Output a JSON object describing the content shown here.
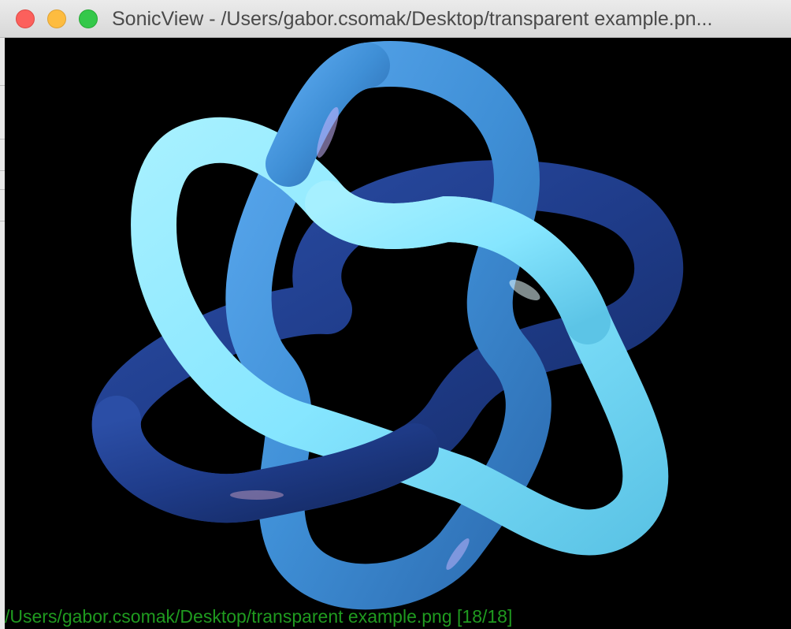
{
  "window": {
    "title": "SonicView - /Users/gabor.csomak/Desktop/transparent example.pn...",
    "controls": {
      "close_icon": "close-icon",
      "minimize_icon": "minimize-icon",
      "zoom_icon": "zoom-icon"
    }
  },
  "viewer": {
    "image_subject": "blue-torus-knot",
    "background_color": "#000000",
    "knot_colors": {
      "light": "#86e6ff",
      "medium": "#3f8fd6",
      "dark": "#1f3c8a"
    }
  },
  "status_bar": {
    "text": "/Users/gabor.csomak/Desktop/transparent example.png [18/18]",
    "color": "#1f9a1f"
  }
}
